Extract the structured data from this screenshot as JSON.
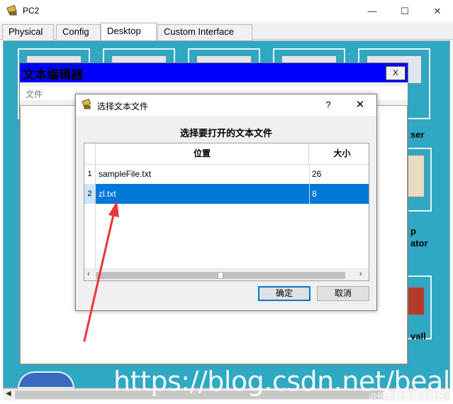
{
  "window": {
    "title": "PC2",
    "min_glyph": "—",
    "max_glyph": "☐",
    "close_glyph": "✕"
  },
  "tabs": [
    {
      "label": "Physical"
    },
    {
      "label": "Config"
    },
    {
      "label": "Desktop"
    },
    {
      "label": "Custom Interface"
    }
  ],
  "desktop": {
    "partial_labels": [
      "ser",
      "p",
      "ator",
      "vall"
    ]
  },
  "editor": {
    "title": "文本编辑器",
    "close_label": "X",
    "menu_file": "文件"
  },
  "dialog": {
    "title": "选择文本文件",
    "help": "?",
    "close": "✕",
    "heading": "选择要打开的文本文件",
    "columns": {
      "position": "位置",
      "size": "大小"
    },
    "rows": [
      {
        "index": "1",
        "name": "sampleFile.txt",
        "size": "26"
      },
      {
        "index": "2",
        "name": "zl.txt",
        "size": "8"
      }
    ],
    "ok": "确定",
    "cancel": "取消"
  },
  "watermark": {
    "url": "https://blog.csdn.net/bealei",
    "secondary": "@稀土掘金技术社区"
  },
  "colors": {
    "editor_title_bg": "#0000ff",
    "selected_row_bg": "#0078d7",
    "desktop_bg": "#2ea8c3",
    "arrow": "#e8353a"
  }
}
